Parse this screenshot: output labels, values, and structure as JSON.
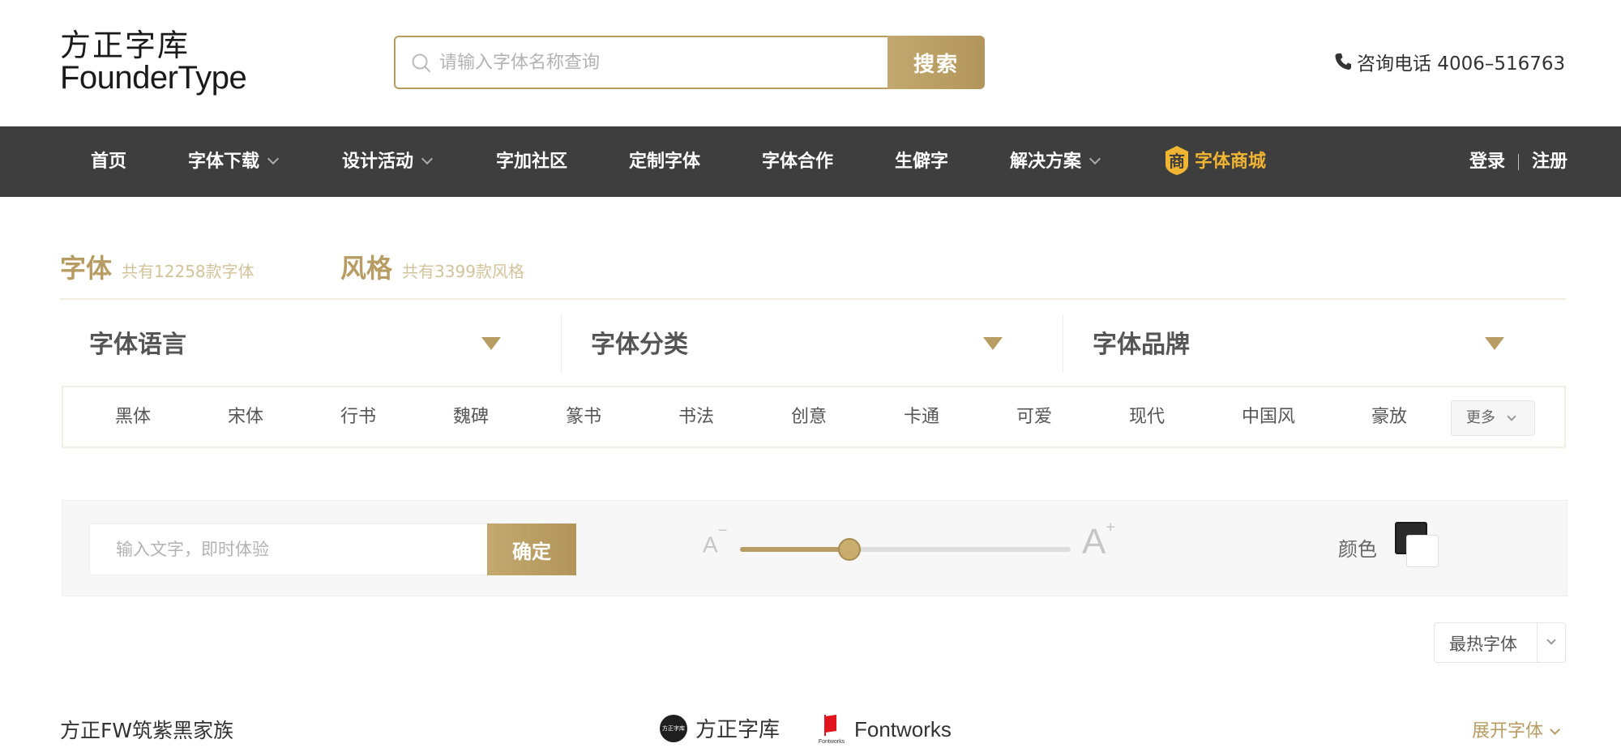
{
  "header": {
    "logo_cn": "方正字库",
    "logo_en": "FounderType",
    "search_placeholder": "请输入字体名称查询",
    "search_button": "搜索",
    "phone_text": "咨询电话 4006–516763"
  },
  "nav": {
    "items": [
      {
        "label": "首页"
      },
      {
        "label": "字体下载"
      },
      {
        "label": "设计活动"
      },
      {
        "label": "字加社区"
      },
      {
        "label": "定制字体"
      },
      {
        "label": "字体合作"
      },
      {
        "label": "生僻字"
      },
      {
        "label": "解决方案"
      }
    ],
    "shop_icon_char": "商",
    "shop_label": "字体商城",
    "login": "登录",
    "register": "注册"
  },
  "tabs": [
    {
      "title": "字体",
      "count": "共有12258款字体"
    },
    {
      "title": "风格",
      "count": "共有3399款风格"
    }
  ],
  "filters": [
    {
      "label": "字体语言"
    },
    {
      "label": "字体分类"
    },
    {
      "label": "字体品牌"
    }
  ],
  "categories": [
    "黑体",
    "宋体",
    "行书",
    "魏碑",
    "篆书",
    "书法",
    "创意",
    "卡通",
    "可爱",
    "现代",
    "中国风",
    "豪放"
  ],
  "more_button": "更多",
  "preview": {
    "input_placeholder": "输入文字，即时体验",
    "confirm_button": "确定",
    "size_minus": "A",
    "size_plus": "A",
    "size_level": 0.33,
    "color_label": "颜色",
    "color_primary": "#2a2a2a",
    "color_secondary": "#ffffff"
  },
  "sort": {
    "selected": "最热字体"
  },
  "font_family": {
    "name": "方正FW筑紫黑家族",
    "brand1": "方正字库",
    "brand1_logo_text": "方正字库",
    "brand2": "Fontworks",
    "brand2_logo_text": "Fontworks",
    "expand_label": "展开字体"
  },
  "colors": {
    "accent": "#b79c63",
    "nav_bg": "#3e3e3e",
    "shop": "#f0b532"
  }
}
